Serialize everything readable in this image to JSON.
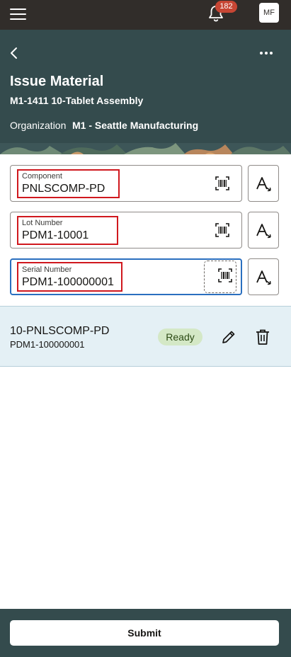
{
  "topbar": {
    "notification_count": "182",
    "user_initials": "MF"
  },
  "header": {
    "title": "Issue Material",
    "subtitle": "M1-1411 10-Tablet Assembly",
    "organization_label": "Organization",
    "organization_value": "M1 - Seattle Manufacturing"
  },
  "fields": [
    {
      "label": "Component",
      "value": "PNLSCOMP-PD"
    },
    {
      "label": "Lot Number",
      "value": "PDM1-10001"
    },
    {
      "label": "Serial Number",
      "value": "PDM1-100000001"
    }
  ],
  "list_items": [
    {
      "title": "10-PNLSCOMP-PD",
      "subtitle": "PDM1-100000001",
      "status": "Ready"
    }
  ],
  "footer": {
    "submit_label": "Submit"
  },
  "colors": {
    "topbar": "#312d2a",
    "header": "#344b4d",
    "badge": "#c74634",
    "status_ready": "#d4e8c6",
    "highlight": "#d0181e",
    "focus": "#2a6fbf"
  },
  "icons": [
    "hamburger-icon",
    "bell-icon",
    "back-arrow-icon",
    "more-options-icon",
    "barcode-scan-icon",
    "font-case-icon",
    "pencil-icon",
    "trash-icon"
  ]
}
